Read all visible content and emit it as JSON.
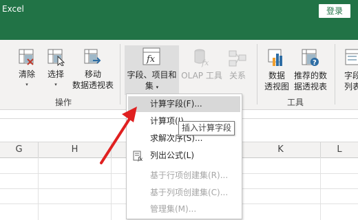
{
  "window": {
    "app_title": "Excel",
    "login_label": "登录"
  },
  "ribbon": {
    "clear": {
      "label": "清除",
      "icon": "clear-icon"
    },
    "select": {
      "label": "选择",
      "icon": "select-icon"
    },
    "move": {
      "label_line1": "移动",
      "label_line2": "数据透视表",
      "icon": "move-pivot-icon"
    },
    "actions_group_label": "操作",
    "fields": {
      "label_line1": "字段、项目和",
      "label_line2": "集",
      "icon": "fields-items-sets-icon"
    },
    "olap": {
      "label": "OLAP 工具",
      "icon": "olap-tools-icon"
    },
    "relations": {
      "label": "关系",
      "icon": "relationships-icon"
    },
    "pivot_chart": {
      "label_line1": "数据",
      "label_line2": "透视图",
      "icon": "pivot-chart-icon"
    },
    "recommended": {
      "label_line1": "推荐的数",
      "label_line2": "据透视表",
      "icon": "recommended-pivot-icon"
    },
    "tools_group_label": "工具",
    "field_list": {
      "label_line1": "字段",
      "label_line2": "列表",
      "icon": "field-list-icon"
    }
  },
  "sheet": {
    "columns": [
      "G",
      "H",
      "K",
      "L"
    ]
  },
  "menu": {
    "items": [
      {
        "label": "计算字段(F)...",
        "state": "highlighted"
      },
      {
        "label": "计算项(I)...",
        "state": "normal"
      },
      {
        "label": "求解次序(S)...",
        "state": "normal"
      },
      {
        "label": "列出公式(L)",
        "state": "normal",
        "icon": "list-formulas-icon"
      },
      {
        "label": "基于行项创建集(R)...",
        "state": "disabled"
      },
      {
        "label": "基于列项创建集(C)...",
        "state": "disabled"
      },
      {
        "label": "管理集(M)...",
        "state": "disabled"
      }
    ]
  },
  "tooltip": {
    "text": "插入计算字段"
  },
  "colors": {
    "title_bar": "#217346",
    "ribbon": "#f3f2f1",
    "annotation_arrow": "#e02020"
  }
}
